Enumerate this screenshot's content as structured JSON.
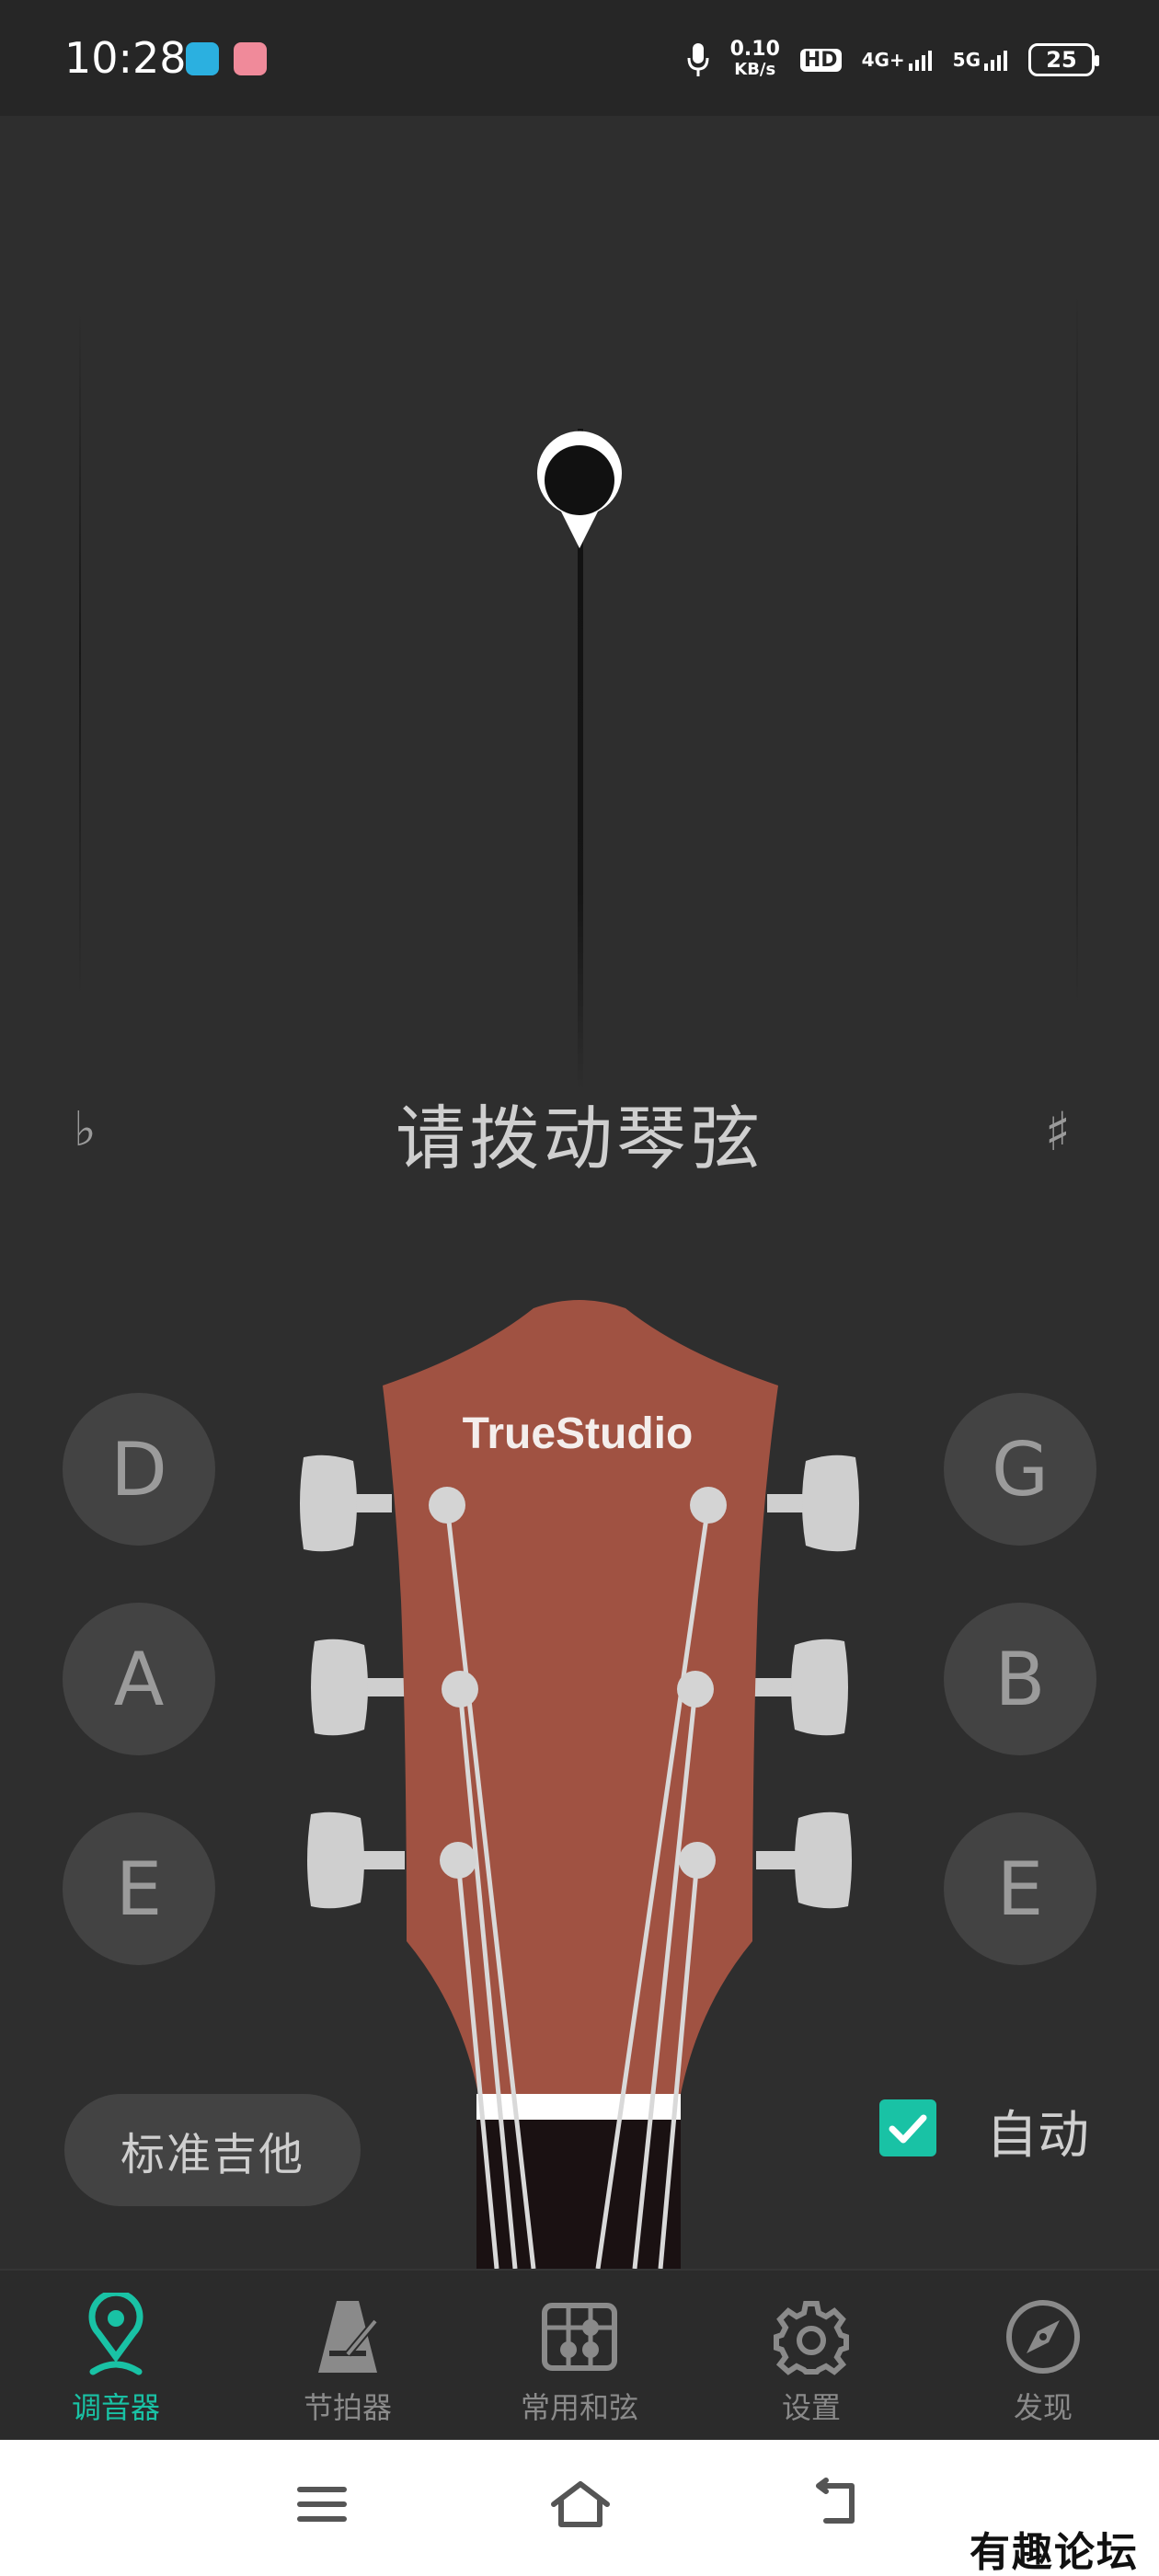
{
  "status_bar": {
    "time": "10:28",
    "speed_value": "0.10",
    "speed_unit": "KB/s",
    "hd_label": "HD",
    "net1": "4G+",
    "net2": "5G",
    "battery": "25"
  },
  "tuner": {
    "prompt": "请拨动琴弦",
    "flat_symbol": "♭",
    "sharp_symbol": "♯",
    "deviation_cents": 0
  },
  "strings": {
    "left": [
      "D",
      "A",
      "E"
    ],
    "right": [
      "G",
      "B",
      "E"
    ]
  },
  "headstock": {
    "brand": "TrueStudio"
  },
  "controls": {
    "preset_label": "标准吉他",
    "auto_label": "自动",
    "auto_checked": true
  },
  "nav": {
    "items": [
      {
        "label": "调音器",
        "icon": "location-pin-icon",
        "active": true
      },
      {
        "label": "节拍器",
        "icon": "metronome-icon",
        "active": false
      },
      {
        "label": "常用和弦",
        "icon": "chord-icon",
        "active": false
      },
      {
        "label": "设置",
        "icon": "gear-icon",
        "active": false
      },
      {
        "label": "发现",
        "icon": "compass-icon",
        "active": false
      }
    ]
  },
  "system_nav": {
    "menu_icon": "menu-icon",
    "home_icon": "home-icon",
    "back_icon": "back-icon"
  },
  "watermark": "有趣论坛",
  "colors": {
    "accent": "#19c2a5",
    "background": "#2e2e2e",
    "headstock": "#a05242"
  }
}
